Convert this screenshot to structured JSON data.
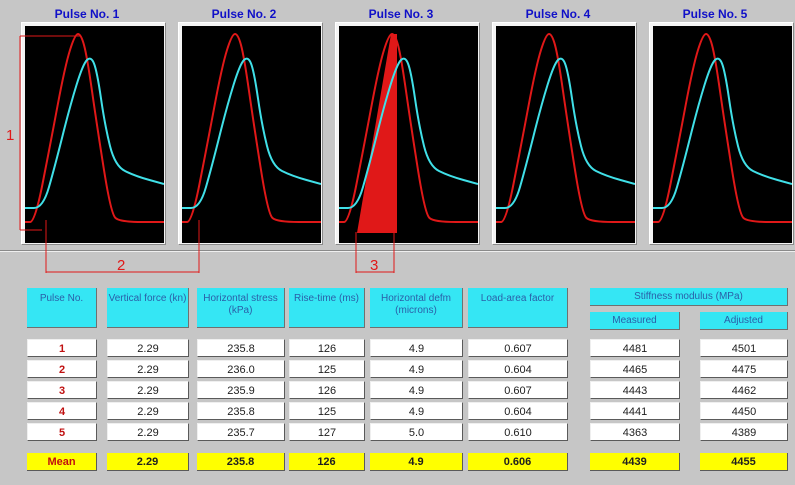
{
  "pulses": [
    {
      "title": "Pulse No. 1"
    },
    {
      "title": "Pulse No. 2"
    },
    {
      "title": "Pulse No. 3"
    },
    {
      "title": "Pulse No. 4"
    },
    {
      "title": "Pulse No. 5"
    }
  ],
  "annotations": {
    "a1": "1",
    "a2": "2",
    "a3": "3"
  },
  "table": {
    "headers": {
      "pulse_no": "Pulse No.",
      "vertical_force": "Vertical force (kn)",
      "horizontal_stress": "Horizontal stress (kPa)",
      "rise_time": "Rise-time (ms)",
      "horizontal_deflection": "Horizontal defm (microns)",
      "load_area_factor": "Load-area factor",
      "stiffness": "Stiffness modulus (MPa)",
      "measured": "Measured",
      "adjusted": "Adjusted"
    },
    "rows": [
      {
        "pulse": "1",
        "force": "2.29",
        "stress": "235.8",
        "rise": "126",
        "defm": "4.9",
        "factor": "0.607",
        "measured": "4481",
        "adjusted": "4501"
      },
      {
        "pulse": "2",
        "force": "2.29",
        "stress": "236.0",
        "rise": "125",
        "defm": "4.9",
        "factor": "0.604",
        "measured": "4465",
        "adjusted": "4475"
      },
      {
        "pulse": "3",
        "force": "2.29",
        "stress": "235.9",
        "rise": "126",
        "defm": "4.9",
        "factor": "0.607",
        "measured": "4443",
        "adjusted": "4462"
      },
      {
        "pulse": "4",
        "force": "2.29",
        "stress": "235.8",
        "rise": "125",
        "defm": "4.9",
        "factor": "0.604",
        "measured": "4441",
        "adjusted": "4450"
      },
      {
        "pulse": "5",
        "force": "2.29",
        "stress": "235.7",
        "rise": "127",
        "defm": "5.0",
        "factor": "0.610",
        "measured": "4363",
        "adjusted": "4389"
      }
    ],
    "mean": {
      "label": "Mean",
      "force": "2.29",
      "stress": "235.8",
      "rise": "126",
      "defm": "4.9",
      "factor": "0.606",
      "measured": "4439",
      "adjusted": "4455"
    }
  },
  "colors": {
    "load_trace": "#e01818",
    "deformation_trace": "#40e0e8",
    "header_bg": "#35e6f4",
    "mean_bg": "#ffff00"
  }
}
